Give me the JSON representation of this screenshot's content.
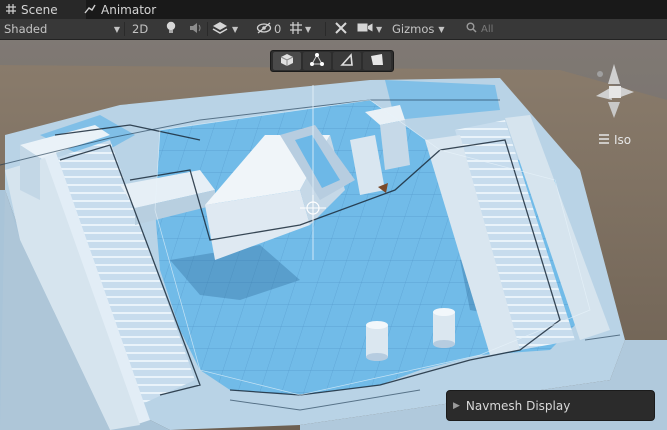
{
  "tabs": [
    {
      "label": "Scene",
      "icon": "grid-icon"
    },
    {
      "label": "Animator",
      "icon": "animator-icon"
    }
  ],
  "toolbar": {
    "draw_mode": "Shaded",
    "mode_2d": "2D",
    "hidden_count": "0",
    "gizmos": "Gizmos"
  },
  "overlay_tools": [
    "cube-icon",
    "vertex-icon",
    "edge-icon",
    "face-icon"
  ],
  "orientation": {
    "label": "Iso"
  },
  "navmesh_panel": {
    "label": "Navmesh Display"
  },
  "colors": {
    "navmesh": "#5ab3e8",
    "geometry": "#d6e4ee",
    "background": "#7a6c5c"
  }
}
